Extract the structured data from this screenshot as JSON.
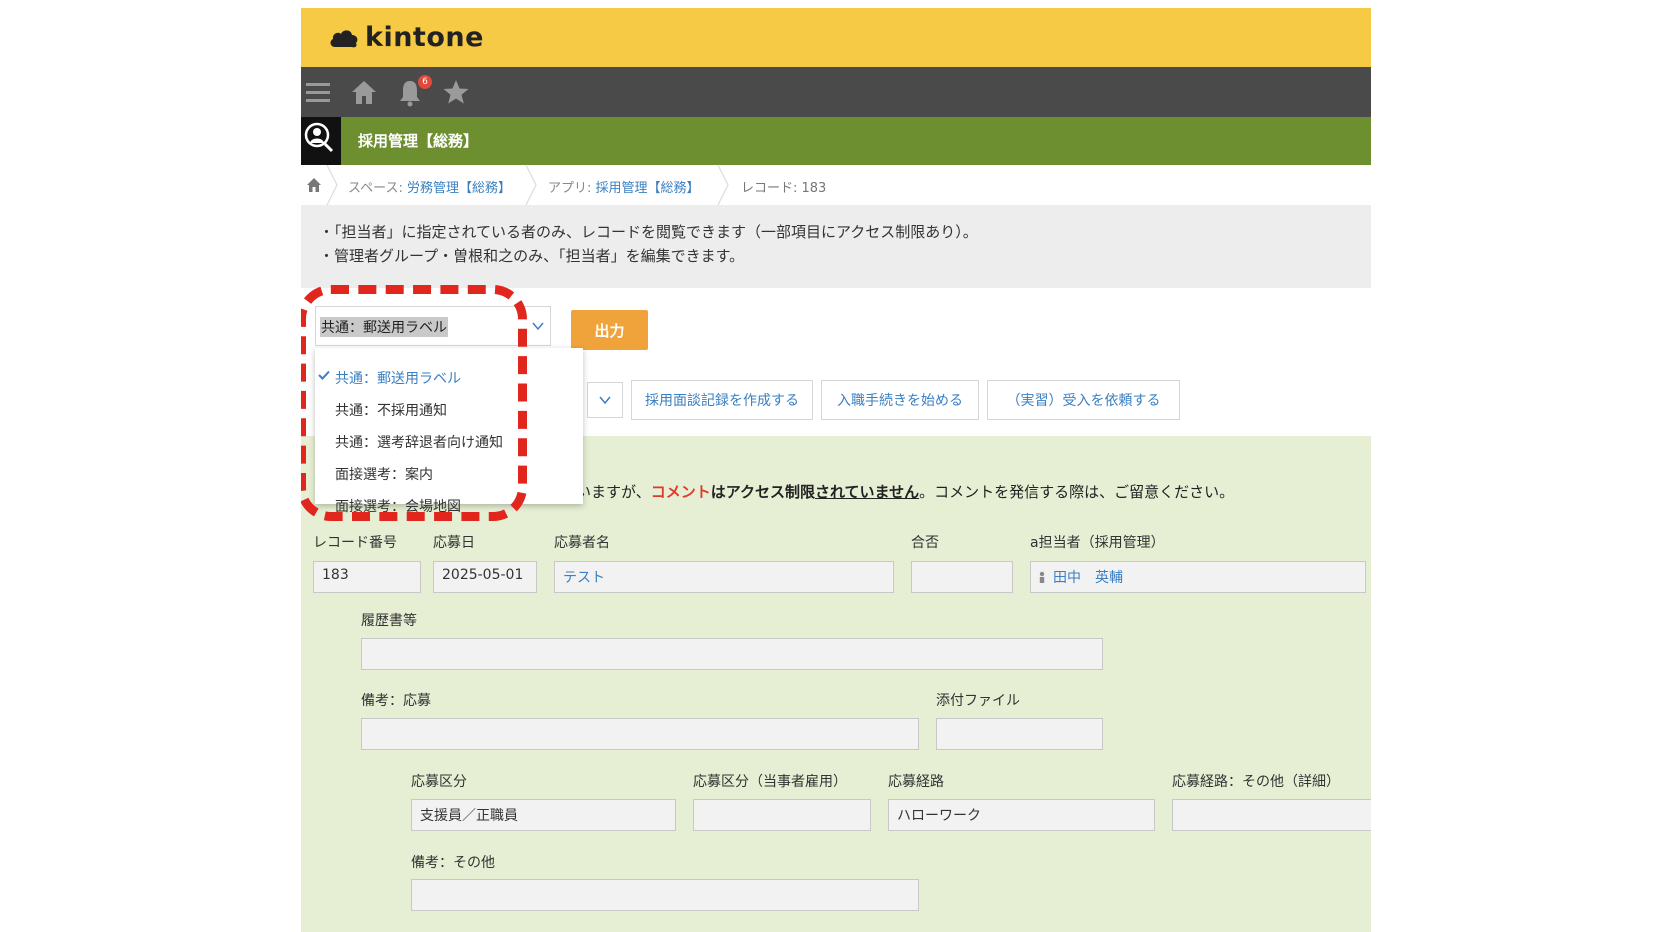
{
  "app": {
    "logo_text": "kintone",
    "notification_count": "6",
    "app_title": "採用管理【総務】",
    "accent_colors": {
      "topbar": "#f7ca45",
      "navbar": "#4a4a4a",
      "appbar": "#6d8f30",
      "output_button": "#f0a33b",
      "record_bg": "#e6efd4",
      "highlight": "#e0261d"
    }
  },
  "breadcrumb": {
    "space_prefix": "スペース: ",
    "space": "労務管理【総務】",
    "app_prefix": "アプリ: ",
    "app": "採用管理【総務】",
    "record": "レコード: 183"
  },
  "notice": {
    "line1": "・「担当者」に指定されている者のみ、レコードを閲覧できます（一部項目にアクセス制限あり）。",
    "line2": "・管理者グループ・曽根和之のみ、「担当者」を編集できます。"
  },
  "print_select": {
    "selected": "共通：郵送用ラベル",
    "options": [
      "共通：郵送用ラベル",
      "共通：不採用通知",
      "共通：選考辞退者向け通知",
      "面接選考：案内",
      "面接選考：会場地図"
    ],
    "output_label": "出力"
  },
  "actions": [
    "採用面談記録を作成する",
    "入職手続きを始める",
    "（実習）受入を依頼する"
  ],
  "comment_note": {
    "part1": "ていますが、",
    "part2": "コメント",
    "part3": "はアクセス制限",
    "part4": "されていません",
    "part5": "。コメントを発信する際は、ご留意ください。"
  },
  "fields": {
    "record_no_label": "レコード番号",
    "record_no": "183",
    "date_label": "応募日",
    "date": "2025-05-01",
    "applicant_label": "応募者名",
    "applicant": "テスト",
    "pass_fail_label": "合否",
    "pass_fail": "",
    "assignee_label": "a担当者（採用管理）",
    "assignee": "田中　英輔",
    "resume_label": "履歴書等",
    "resume": "",
    "note_apply_label": "備考：応募",
    "note_apply": "",
    "attachment_label": "添付ファイル",
    "attachment": "",
    "category_label": "応募区分",
    "category": "支援員／正職員",
    "category_self_label": "応募区分（当事者雇用）",
    "category_self": "",
    "route_label": "応募経路",
    "route": "ハローワーク",
    "route_other_label": "応募経路：その他（詳細）",
    "route_other": "",
    "note_other_label": "備考：その他",
    "note_other": ""
  },
  "icons": [
    "hamburger-icon",
    "home-icon",
    "bell-icon",
    "star-icon",
    "app-search-icon",
    "check-icon",
    "chevron-down-icon",
    "user-icon"
  ]
}
